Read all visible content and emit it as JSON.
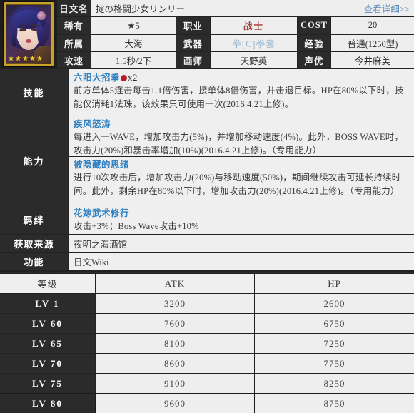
{
  "card": {
    "portrait": {
      "alt_name": "character-portrait",
      "rarity_stars": 5,
      "star_glyph": "★",
      "frame_color": "#c9a227"
    },
    "name_row": {
      "label": "日文名",
      "value": "掟の格闘少女リンリー",
      "detail_link": "查看详细>>"
    },
    "info_rows": [
      {
        "label1": "稀有",
        "value1": "★5",
        "label2": "职业",
        "value2": "战士",
        "value2_color": "#a53b3b",
        "label3": "COST",
        "value3": "20"
      },
      {
        "label1": "所属",
        "value1": "大海",
        "label2": "武器",
        "value2": "拳[C]拳套",
        "value2_color": "#96b6cf",
        "label3": "经验",
        "value3": "普通(1250型)"
      },
      {
        "label1": "攻速",
        "value1": "1.5秒/2下",
        "label2": "画师",
        "value2": "天野英",
        "value2_color": "#333333",
        "label3": "声优",
        "value3": "今井麻美"
      }
    ],
    "skill_section": {
      "label": "技能",
      "entries": [
        {
          "title": "六阳大招拳",
          "orb": true,
          "orb_color": "#b81c22",
          "count": "x2",
          "text": "前方单体5连击每击1.1倍伤害，接单体8倍伤害，并击退目标。HP在80%以下时，技能仅消耗1法珠，该效果只可使用一次(2016.4.21上修)。"
        }
      ]
    },
    "ability_section": {
      "label": "能力",
      "entries": [
        {
          "title": "疾风怒涛",
          "text": "每进入一WAVE，增加攻击力(5%)，并增加移动速度(4%)。此外，BOSS WAVE时，攻击力(20%)和暴击率增加(10%)(2016.4.21上修)。（专用能力）"
        },
        {
          "title": "被隐藏的思绪",
          "text": "进行10次攻击后，增加攻击力(20%)与移动速度(50%)，期间继续攻击可延长持续时间。此外，剩余HP在80%以下时，增加攻击力(20%)(2016.4.21上修)。（专用能力）"
        }
      ]
    },
    "bond_section": {
      "label": "羁绊",
      "entries": [
        {
          "title": "花嫁武术修行",
          "text": "攻击+3%；Boss Wave攻击+10%"
        }
      ]
    },
    "source_row": {
      "label": "获取来源",
      "value": "夜明之海酒馆"
    },
    "function_row": {
      "label": "功能",
      "value": "日文Wiki",
      "is_link": true
    }
  },
  "stats_table": {
    "headers": [
      "等级",
      "ATK",
      "HP"
    ],
    "rows": [
      {
        "level": "LV 1",
        "atk": "3200",
        "hp": "2600"
      },
      {
        "level": "LV 60",
        "atk": "7600",
        "hp": "6750"
      },
      {
        "level": "LV 65",
        "atk": "8100",
        "hp": "7250"
      },
      {
        "level": "LV 70",
        "atk": "8600",
        "hp": "7750"
      },
      {
        "level": "LV 75",
        "atk": "9100",
        "hp": "8250"
      },
      {
        "level": "LV 80",
        "atk": "9600",
        "hp": "8750"
      }
    ]
  }
}
